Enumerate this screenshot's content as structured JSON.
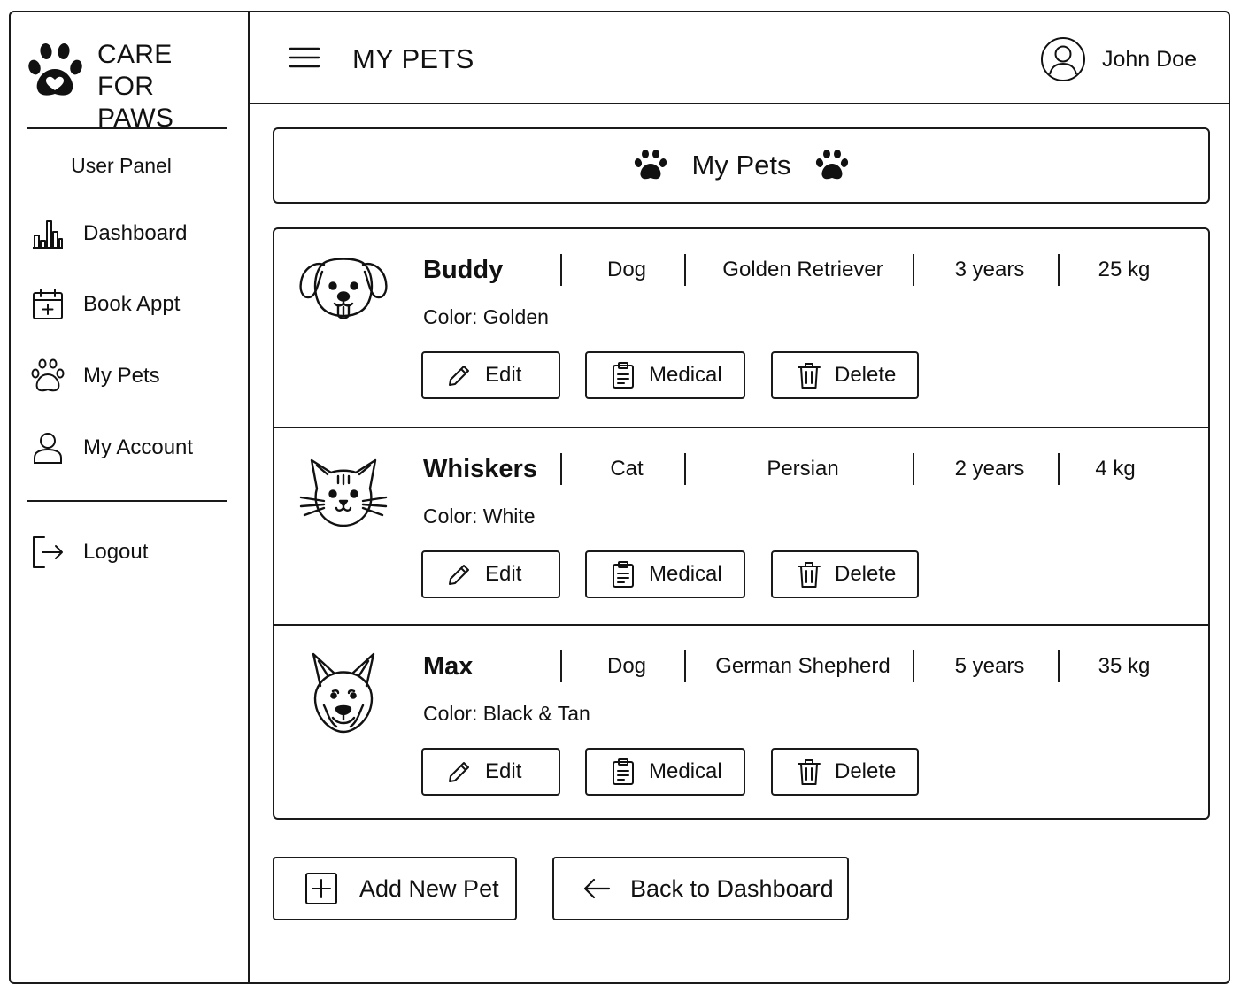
{
  "brand": {
    "name_line1": "CARE FOR",
    "name_line2": "PAWS",
    "logo_icon": "paw-heart-icon"
  },
  "sidebar": {
    "panel_title": "User Panel",
    "items": [
      {
        "label": "Dashboard",
        "icon": "bar-chart-icon"
      },
      {
        "label": "Book Appt",
        "icon": "calendar-plus-icon"
      },
      {
        "label": "My Pets",
        "icon": "paw-icon"
      },
      {
        "label": "My Account",
        "icon": "user-icon"
      }
    ],
    "logout": {
      "label": "Logout",
      "icon": "logout-icon"
    }
  },
  "header": {
    "title": "MY PETS",
    "menu_icon": "hamburger-menu-icon",
    "user_name": "John Doe",
    "user_icon": "user-circle-icon"
  },
  "main": {
    "section_title": "My Pets",
    "pets": [
      {
        "name": "Buddy",
        "species": "Dog",
        "breed": "Golden Retriever",
        "age": "3 years",
        "weight": "25 kg",
        "color": "Color: Golden",
        "avatar": "puppy-icon"
      },
      {
        "name": "Whiskers",
        "species": "Cat",
        "breed": "Persian",
        "age": "2 years",
        "weight": "4 kg",
        "color": "Color: White",
        "avatar": "cat-icon"
      },
      {
        "name": "Max",
        "species": "Dog",
        "breed": "German Shepherd",
        "age": "5 years",
        "weight": "35 kg",
        "color": "Color: Black & Tan",
        "avatar": "shepherd-dog-icon"
      }
    ],
    "actions": {
      "edit": "Edit",
      "medical": "Medical",
      "delete": "Delete"
    },
    "add_pet_label": "Add New Pet",
    "back_label": "Back to Dashboard"
  },
  "colors": {
    "ink": "#1a1a1a",
    "background": "#ffffff"
  }
}
